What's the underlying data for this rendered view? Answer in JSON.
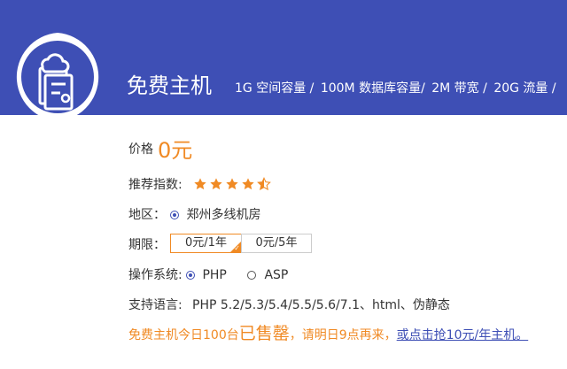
{
  "header": {
    "title": "免费主机",
    "specs": [
      "1G 空间容量 /",
      "100M 数据库容量/",
      "2M 带宽 /",
      "20G 流量 /"
    ]
  },
  "price": {
    "label": "价格",
    "value": "0元"
  },
  "rating": {
    "label": "推荐指数:",
    "value": 4.5,
    "max": 5
  },
  "region": {
    "label": "地区：",
    "option": "郑州多线机房"
  },
  "period": {
    "label": "期限：",
    "options": [
      "0元/1年",
      "0元/5年"
    ],
    "selected": 0
  },
  "os": {
    "label": "操作系统:",
    "options": [
      "PHP",
      "ASP"
    ],
    "selected": 0
  },
  "lang": {
    "label": "支持语言:",
    "value": "PHP 5.2/5.3/5.4/5.5/5.6/7.1、html、伪静态"
  },
  "notice": {
    "prefix": "免费主机今日100台",
    "highlight": "已售罄",
    "middle": "，请明日9点再来，",
    "link": "或点击抢10元/年主机。"
  },
  "colors": {
    "brand": "#3e4fb5",
    "accent": "#f08a24"
  },
  "icons": {
    "badge": "cloud-server-icon",
    "star": "star-icon"
  }
}
